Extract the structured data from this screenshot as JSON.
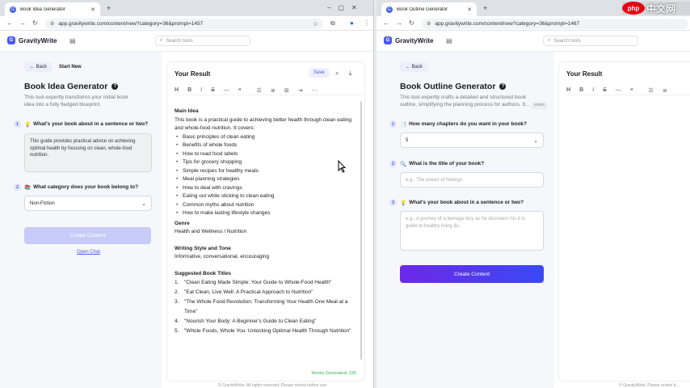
{
  "left": {
    "tab_title": "Book Idea Generator",
    "url": "app.gravitywrite.com/content/new?category=36&prompt=1457",
    "brand": "GravityWrite",
    "search_placeholder": "Search tools",
    "back_label": "Back",
    "start_new_label": "Start New",
    "page_title": "Book Idea Generator",
    "description": "This tool expertly transforms your initial book idea into a fully fledged blueprint.",
    "step1_num": "1",
    "step1_label": "What's your book about in a sentence or two?",
    "step1_value": "This guide provides practical advice on achieving optimal health by focusing on clean, whole-food nutrition.",
    "step2_num": "2",
    "step2_label": "What category does your book belong to?",
    "step2_value": "Non-Fiction",
    "create_label": "Create Content",
    "open_chat_label": "Open Chat",
    "result_title": "Your Result",
    "save_label": "Save",
    "words_generated": "Words Generated: 135",
    "footer": "© GravityWrite. All rights reserved. Please review before use.",
    "result": {
      "main_idea_heading": "Main Idea",
      "main_idea_text": "This book is a practical guide to achieving better health through clean eating and whole-food nutrition. It covers:",
      "bullets": [
        "Basic principles of clean eating",
        "Benefits of whole foods",
        "How to read food labels",
        "Tips for grocery shopping",
        "Simple recipes for healthy meals",
        "Meal planning strategies",
        "How to deal with cravings",
        "Eating out while sticking to clean eating",
        "Common myths about nutrition",
        "How to make lasting lifestyle changes"
      ],
      "genre_heading": "Genre",
      "genre_text": "Health and Wellness / Nutrition",
      "style_heading": "Writing Style and Tone",
      "style_text": "Informative, conversational, encouraging",
      "titles_heading": "Suggested Book Titles",
      "titles": [
        "\"Clean Eating Made Simple: Your Guide to Whole-Food Health\"",
        "\"Eat Clean, Live Well: A Practical Approach to Nutrition\"",
        "\"The Whole Food Revolution: Transforming Your Health One Meal at a Time\"",
        "\"Nourish Your Body: A Beginner's Guide to Clean Eating\"",
        "\"Whole Foods, Whole You: Unlocking Optimal Health Through Nutrition\""
      ]
    }
  },
  "right": {
    "tab_title": "Book Outline Generator",
    "url": "app.gravitywrite.com/content/new?category=36&prompt=1467",
    "brand": "GravityWrite",
    "search_placeholder": "Search tools",
    "back_label": "Back",
    "page_title": "Book Outline Generator",
    "description_line1": "This tool expertly crafts a detailed and structured book",
    "description_line2": "outline, simplifying the planning process for authors. It...",
    "more_label": "more",
    "step1_num": "1",
    "step1_label": "How many chapters do you want in your book?",
    "step1_value": "5",
    "step2_num": "2",
    "step2_label": "What is the title of your book?",
    "step2_placeholder": "e.g., The power of feelings",
    "step3_num": "3",
    "step3_label": "What's your book about in a sentence or two?",
    "step3_placeholder": "e.g., A journey of a teenage boy as he discovers his it is guide to healthy living &c.",
    "create_label": "Create Content",
    "result_title": "Your Result",
    "footer": "© GravityWrite. Please review b..."
  },
  "watermark": {
    "php": "php",
    "cn": "中文网"
  },
  "colors": {
    "brand": "#4a58f0",
    "button_gradient_start": "#6d28e8",
    "button_gradient_end": "#3949f5",
    "words_green": "#37b24d"
  }
}
